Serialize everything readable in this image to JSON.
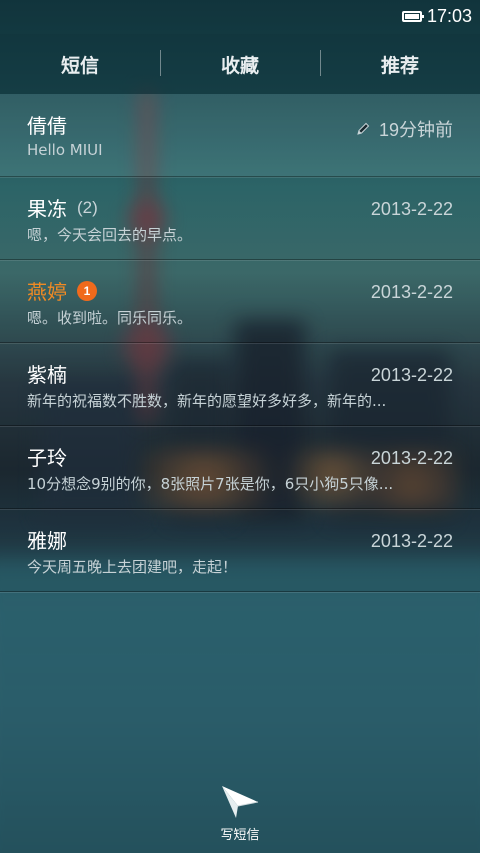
{
  "status_bar": {
    "time": "17:03",
    "battery_icon": "battery-icon"
  },
  "tabs": [
    {
      "label": "短信",
      "active": true
    },
    {
      "label": "收藏",
      "active": false
    },
    {
      "label": "推荐",
      "active": false
    }
  ],
  "conversations": [
    {
      "name": "倩倩",
      "count": "",
      "unread_badge": "",
      "time": "19分钟前",
      "draft": true,
      "preview": "Hello MIUI"
    },
    {
      "name": "果冻",
      "count": "(2)",
      "unread_badge": "",
      "time": "2013-2-22",
      "draft": false,
      "preview": "嗯，今天会回去的早点。"
    },
    {
      "name": "燕婷",
      "count": "",
      "unread_badge": "1",
      "time": "2013-2-22",
      "draft": false,
      "unread": true,
      "preview": "嗯。收到啦。同乐同乐。"
    },
    {
      "name": "紫楠",
      "count": "",
      "unread_badge": "",
      "time": "2013-2-22",
      "draft": false,
      "preview": "新年的祝福数不胜数，新年的愿望好多好多，新年的..."
    },
    {
      "name": "子玲",
      "count": "",
      "unread_badge": "",
      "time": "2013-2-22",
      "draft": false,
      "preview": "10分想念9别的你，8张照片7张是你，6只小狗5只像..."
    },
    {
      "name": "雅娜",
      "count": "",
      "unread_badge": "",
      "time": "2013-2-22",
      "draft": false,
      "preview": "今天周五晚上去团建吧，走起！"
    }
  ],
  "compose": {
    "label": "写短信",
    "icon": "paper-plane-icon"
  },
  "colors": {
    "unread_name": "#f08a24",
    "badge": "#f06a1c"
  }
}
